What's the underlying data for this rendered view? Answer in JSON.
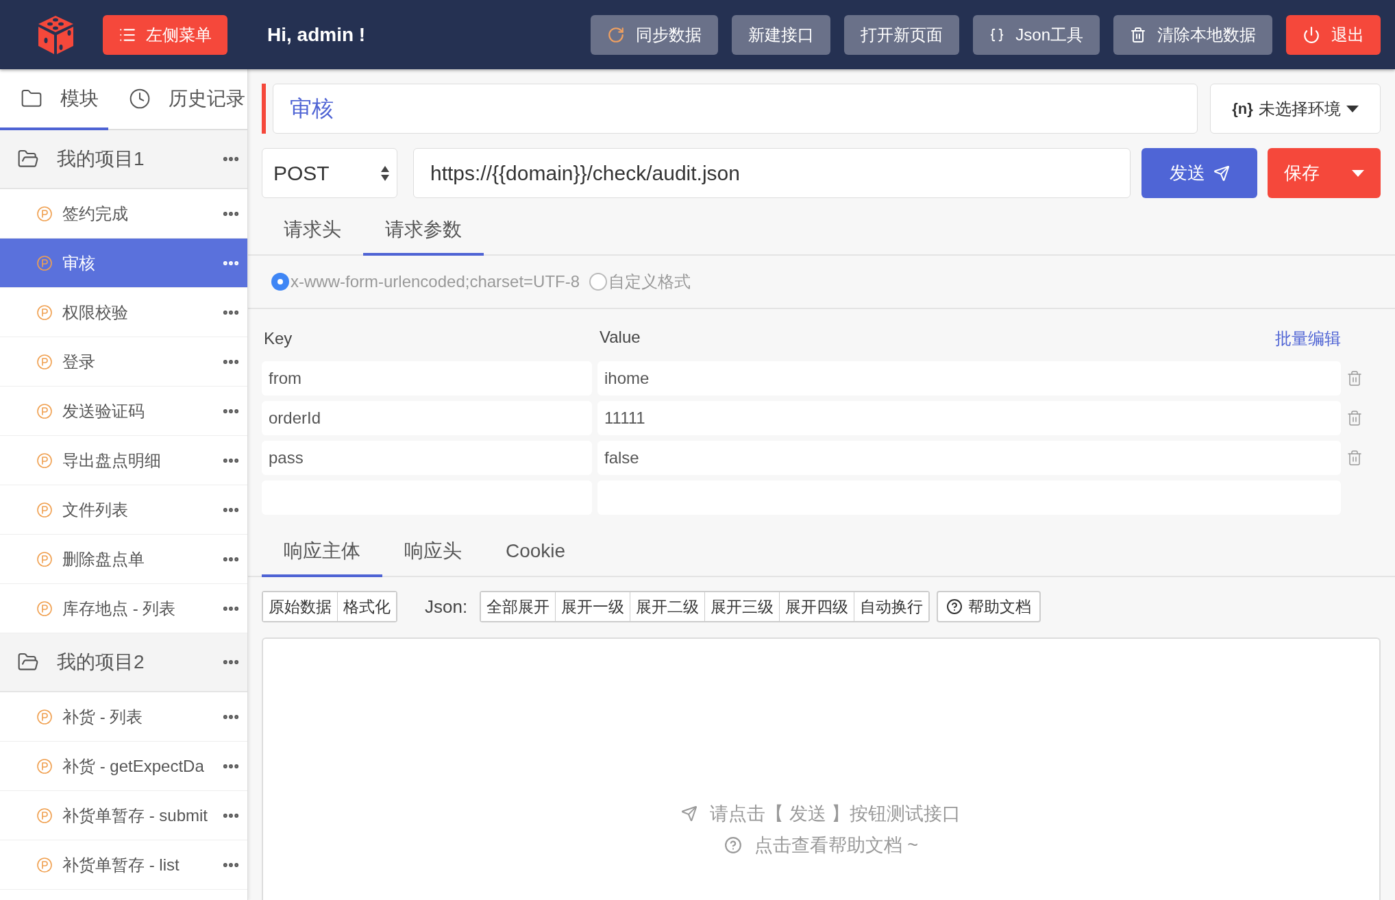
{
  "header": {
    "menu_button": "左侧菜单",
    "greeting": "Hi, admin !",
    "actions": [
      {
        "label": "同步数据",
        "kind": "sync"
      },
      {
        "label": "新建接口",
        "kind": "plain"
      },
      {
        "label": "打开新页面",
        "kind": "plain"
      },
      {
        "label": "Json工具",
        "kind": "json"
      },
      {
        "label": "清除本地数据",
        "kind": "trash"
      },
      {
        "label": "退出",
        "kind": "logout"
      }
    ]
  },
  "sidebar": {
    "tabs": [
      {
        "label": "模块",
        "kind": "folder",
        "selected": true
      },
      {
        "label": "历史记录",
        "kind": "history",
        "selected": false
      }
    ],
    "projects": [
      {
        "name": "我的项目1",
        "expanded": true,
        "children": [
          {
            "name": "签约完成",
            "selected": false
          },
          {
            "name": "审核",
            "selected": true
          },
          {
            "name": "权限校验",
            "selected": false
          },
          {
            "name": "登录",
            "selected": false
          },
          {
            "name": "发送验证码",
            "selected": false
          },
          {
            "name": "导出盘点明细",
            "selected": false
          },
          {
            "name": "文件列表",
            "selected": false
          },
          {
            "name": "删除盘点单",
            "selected": false
          },
          {
            "name": "库存地点 - 列表",
            "selected": false
          }
        ]
      },
      {
        "name": "我的项目2",
        "expanded": true,
        "children": [
          {
            "name": "补货 - 列表",
            "selected": false
          },
          {
            "name": "补货 - getExpectDa",
            "selected": false
          },
          {
            "name": "补货单暂存 - submit",
            "selected": false
          },
          {
            "name": "补货单暂存 - list",
            "selected": false
          }
        ]
      }
    ]
  },
  "request": {
    "name": "审核",
    "environment_tag": "{n}",
    "environment": "未选择环境",
    "method": "POST",
    "url": "https://{{domain}}/check/audit.json",
    "send_button": "发送",
    "save_button": "保存",
    "tabs": [
      {
        "label": "请求头",
        "selected": false
      },
      {
        "label": "请求参数",
        "selected": true
      }
    ],
    "formats": [
      {
        "label": "x-www-form-urlencoded;charset=UTF-8",
        "selected": true
      },
      {
        "label": "自定义格式",
        "selected": false
      }
    ],
    "params_header": {
      "key": "Key",
      "value": "Value",
      "bulk_edit": "批量编辑"
    },
    "params": [
      {
        "key": "from",
        "value": "ihome"
      },
      {
        "key": "orderId",
        "value": "11111"
      },
      {
        "key": "pass",
        "value": "false"
      }
    ]
  },
  "response": {
    "tabs": [
      {
        "label": "响应主体",
        "selected": true
      },
      {
        "label": "响应头",
        "selected": false
      },
      {
        "label": "Cookie",
        "selected": false
      }
    ],
    "view_buttons": [
      "原始数据",
      "格式化"
    ],
    "json_label": "Json:",
    "expand_buttons": [
      "全部展开",
      "展开一级",
      "展开二级",
      "展开三级",
      "展开四级",
      "自动换行"
    ],
    "help_button": "帮助文档",
    "hint_send": "请点击【 发送 】按钮测试接口",
    "hint_help": "点击查看帮助文档 ~"
  }
}
